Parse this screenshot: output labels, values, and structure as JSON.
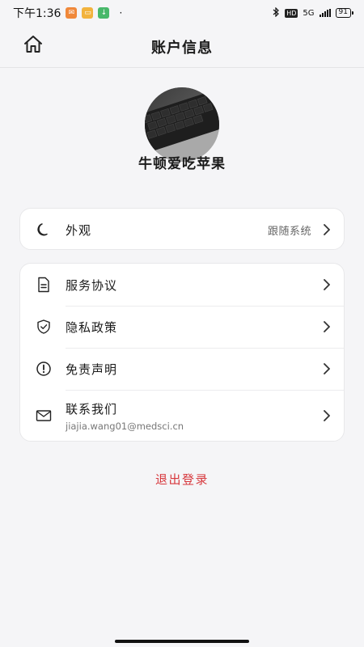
{
  "status_bar": {
    "time": "下午1:36",
    "notif_icons": [
      "orange-app-icon",
      "yellow-message-icon",
      "green-download-icon"
    ],
    "dot": "·",
    "network": "5G",
    "hd": "HD",
    "battery": "91"
  },
  "header": {
    "title": "账户信息",
    "home_icon": "home-icon"
  },
  "profile": {
    "avatar_icon": "keyboard-photo-avatar",
    "username": "牛顿爱吃苹果"
  },
  "appearance": {
    "label": "外观",
    "value": "跟随系统",
    "icon": "moon-icon"
  },
  "list": [
    {
      "label": "服务协议",
      "icon": "document-icon"
    },
    {
      "label": "隐私政策",
      "icon": "shield-check-icon"
    },
    {
      "label": "免责声明",
      "icon": "alert-circle-icon"
    },
    {
      "label": "联系我们",
      "sub": "jiajia.wang01@medsci.cn",
      "icon": "mail-icon"
    }
  ],
  "logout": "退出登录",
  "colors": {
    "background": "#f5f5f7",
    "card": "#ffffff",
    "logout": "#d7383d",
    "secondary_text": "#666666"
  }
}
